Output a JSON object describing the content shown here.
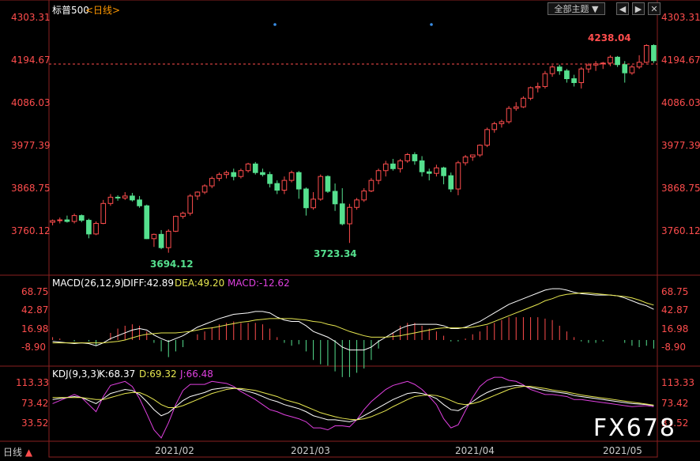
{
  "title": "标普500",
  "period": "<日线>",
  "toolbar": {
    "theme_select": "全部主题",
    "btn_prev": "◀",
    "btn_next": "▶",
    "btn_close": "✕"
  },
  "price_axis": [
    "4303.31",
    "4194.67",
    "4086.03",
    "3977.39",
    "3868.75",
    "3760.12"
  ],
  "annotations": {
    "high": "4238.04",
    "low1": "3694.12",
    "low2": "3723.34"
  },
  "macd": {
    "label": "MACD(26,12,9)",
    "diff": "DIFF:42.89",
    "dea": "DEA:49.20",
    "macd": "MACD:-12.62",
    "axis": [
      "68.75",
      "42.87",
      "16.98",
      "-8.90"
    ]
  },
  "kdj": {
    "label": "KDJ(9,3,3)",
    "k": "K:68.37",
    "d": "D:69.32",
    "j": "J:66.48",
    "axis": [
      "113.33",
      "73.42",
      "33.52"
    ]
  },
  "dates": [
    "2021/02",
    "2021/03",
    "2021/04",
    "2021/05"
  ],
  "period_tab": "日线",
  "watermark": "FX678",
  "colors": {
    "up": "#ff4d4d",
    "down": "#55e08e",
    "diff": "#ffffff",
    "dea": "#e8e850",
    "jline": "#e040e0",
    "grid": "#8a1f1f"
  },
  "chart_data": {
    "type": "candlestick",
    "ohlc": [
      [
        3783,
        3790,
        3775,
        3787
      ],
      [
        3787,
        3795,
        3780,
        3789
      ],
      [
        3789,
        3800,
        3782,
        3785
      ],
      [
        3785,
        3805,
        3780,
        3800
      ],
      [
        3800,
        3803,
        3783,
        3788
      ],
      [
        3788,
        3792,
        3742,
        3753
      ],
      [
        3753,
        3785,
        3750,
        3780
      ],
      [
        3780,
        3840,
        3778,
        3831
      ],
      [
        3831,
        3855,
        3825,
        3847
      ],
      [
        3847,
        3852,
        3838,
        3845
      ],
      [
        3845,
        3860,
        3840,
        3850
      ],
      [
        3850,
        3858,
        3836,
        3840
      ],
      [
        3840,
        3850,
        3820,
        3825
      ],
      [
        3825,
        3828,
        3740,
        3741
      ],
      [
        3741,
        3754,
        3720,
        3752
      ],
      [
        3752,
        3763,
        3714,
        3718
      ],
      [
        3718,
        3765,
        3705,
        3760
      ],
      [
        3760,
        3800,
        3758,
        3798
      ],
      [
        3798,
        3810,
        3792,
        3806
      ],
      [
        3806,
        3855,
        3800,
        3850
      ],
      [
        3850,
        3862,
        3840,
        3860
      ],
      [
        3860,
        3880,
        3855,
        3876
      ],
      [
        3876,
        3900,
        3870,
        3895
      ],
      [
        3895,
        3910,
        3888,
        3905
      ],
      [
        3905,
        3915,
        3895,
        3910
      ],
      [
        3910,
        3920,
        3890,
        3900
      ],
      [
        3900,
        3920,
        3895,
        3915
      ],
      [
        3915,
        3935,
        3910,
        3932
      ],
      [
        3932,
        3937,
        3905,
        3910
      ],
      [
        3910,
        3920,
        3900,
        3905
      ],
      [
        3905,
        3912,
        3872,
        3882
      ],
      [
        3882,
        3890,
        3855,
        3865
      ],
      [
        3865,
        3900,
        3855,
        3890
      ],
      [
        3890,
        3915,
        3885,
        3910
      ],
      [
        3910,
        3914,
        3843,
        3868
      ],
      [
        3868,
        3872,
        3800,
        3820
      ],
      [
        3820,
        3860,
        3815,
        3842
      ],
      [
        3842,
        3905,
        3838,
        3900
      ],
      [
        3900,
        3903,
        3858,
        3862
      ],
      [
        3862,
        3882,
        3812,
        3830
      ],
      [
        3830,
        3870,
        3775,
        3779
      ],
      [
        3779,
        3830,
        3730,
        3821
      ],
      [
        3821,
        3845,
        3815,
        3840
      ],
      [
        3840,
        3870,
        3835,
        3863
      ],
      [
        3863,
        3896,
        3860,
        3890
      ],
      [
        3890,
        3920,
        3880,
        3915
      ],
      [
        3915,
        3940,
        3900,
        3932
      ],
      [
        3932,
        3945,
        3915,
        3920
      ],
      [
        3920,
        3945,
        3910,
        3940
      ],
      [
        3940,
        3960,
        3935,
        3956
      ],
      [
        3956,
        3962,
        3930,
        3940
      ],
      [
        3940,
        3952,
        3900,
        3912
      ],
      [
        3912,
        3920,
        3890,
        3908
      ],
      [
        3908,
        3930,
        3900,
        3922
      ],
      [
        3922,
        3925,
        3880,
        3902
      ],
      [
        3902,
        3910,
        3860,
        3868
      ],
      [
        3868,
        3940,
        3852,
        3935
      ],
      [
        3935,
        3955,
        3928,
        3950
      ],
      [
        3950,
        3955,
        3940,
        3955
      ],
      [
        3955,
        3982,
        3950,
        3980
      ],
      [
        3980,
        4025,
        3975,
        4020
      ],
      [
        4020,
        4040,
        4012,
        4035
      ],
      [
        4035,
        4045,
        4025,
        4040
      ],
      [
        4040,
        4080,
        4035,
        4074
      ],
      [
        4074,
        4090,
        4068,
        4078
      ],
      [
        4078,
        4105,
        4075,
        4100
      ],
      [
        4100,
        4130,
        4095,
        4127
      ],
      [
        4127,
        4140,
        4115,
        4130
      ],
      [
        4130,
        4170,
        4125,
        4163
      ],
      [
        4163,
        4185,
        4155,
        4180
      ],
      [
        4180,
        4186,
        4160,
        4170
      ],
      [
        4170,
        4175,
        4140,
        4150
      ],
      [
        4150,
        4160,
        4130,
        4140
      ],
      [
        4140,
        4180,
        4125,
        4175
      ],
      [
        4175,
        4190,
        4165,
        4185
      ],
      [
        4185,
        4195,
        4170,
        4188
      ],
      [
        4188,
        4193,
        4175,
        4190
      ],
      [
        4190,
        4210,
        4182,
        4205
      ],
      [
        4205,
        4208,
        4180,
        4186
      ],
      [
        4186,
        4195,
        4140,
        4165
      ],
      [
        4165,
        4185,
        4160,
        4180
      ],
      [
        4180,
        4210,
        4175,
        4192
      ],
      [
        4192,
        4238,
        4190,
        4235
      ],
      [
        4235,
        4238,
        4190,
        4196
      ]
    ],
    "diff": [
      -2,
      -3,
      -4,
      -5,
      -4,
      -5,
      -8,
      -4,
      2,
      6,
      10,
      14,
      16,
      14,
      7,
      2,
      -2,
      2,
      6,
      12,
      18,
      22,
      26,
      30,
      33,
      36,
      37,
      38,
      40,
      40,
      38,
      32,
      28,
      26,
      26,
      20,
      12,
      8,
      4,
      -2,
      -10,
      -14,
      -14,
      -14,
      -10,
      -2,
      4,
      10,
      16,
      20,
      22,
      22,
      22,
      22,
      20,
      16,
      16,
      18,
      22,
      26,
      32,
      38,
      44,
      50,
      54,
      58,
      62,
      66,
      70,
      72,
      72,
      70,
      67,
      65,
      64,
      63,
      63,
      63,
      62,
      59,
      55,
      51,
      48,
      43
    ],
    "dea": [
      -4,
      -4,
      -4,
      -4,
      -4,
      -4,
      -4,
      -4,
      -3,
      -2,
      0,
      3,
      6,
      8,
      9,
      10,
      10,
      10,
      11,
      12,
      14,
      16,
      17,
      19,
      21,
      23,
      25,
      26,
      28,
      29,
      30,
      30,
      30,
      30,
      29,
      28,
      26,
      25,
      22,
      20,
      16,
      12,
      9,
      6,
      4,
      4,
      4,
      5,
      6,
      8,
      10,
      12,
      14,
      16,
      17,
      17,
      17,
      17,
      18,
      20,
      22,
      26,
      30,
      34,
      38,
      42,
      46,
      50,
      55,
      58,
      62,
      64,
      65,
      66,
      66,
      65,
      64,
      63,
      62,
      61,
      59,
      56,
      52,
      49
    ],
    "k": [
      80,
      82,
      84,
      86,
      84,
      78,
      72,
      82,
      92,
      96,
      100,
      98,
      90,
      76,
      60,
      48,
      54,
      66,
      78,
      86,
      90,
      94,
      100,
      102,
      104,
      103,
      100,
      96,
      92,
      86,
      80,
      76,
      70,
      66,
      62,
      56,
      48,
      44,
      40,
      40,
      38,
      36,
      40,
      48,
      56,
      64,
      72,
      80,
      86,
      92,
      94,
      92,
      88,
      82,
      70,
      60,
      58,
      66,
      76,
      86,
      94,
      100,
      104,
      106,
      108,
      107,
      104,
      101,
      98,
      96,
      94,
      92,
      88,
      86,
      84,
      82,
      80,
      78,
      76,
      74,
      72,
      71,
      70,
      68
    ],
    "d": [
      84,
      84,
      84,
      84,
      84,
      82,
      80,
      80,
      84,
      88,
      92,
      94,
      94,
      88,
      80,
      70,
      64,
      64,
      68,
      74,
      80,
      86,
      92,
      96,
      100,
      102,
      102,
      100,
      98,
      94,
      90,
      86,
      80,
      76,
      72,
      66,
      60,
      54,
      50,
      46,
      43,
      41,
      40,
      42,
      46,
      52,
      58,
      66,
      73,
      80,
      86,
      88,
      89,
      88,
      84,
      78,
      72,
      70,
      72,
      76,
      82,
      88,
      94,
      100,
      104,
      106,
      106,
      104,
      102,
      99,
      97,
      95,
      92,
      89,
      87,
      85,
      83,
      81,
      79,
      77,
      75,
      73,
      71,
      69
    ],
    "j": [
      72,
      78,
      84,
      90,
      84,
      70,
      56,
      86,
      108,
      112,
      116,
      106,
      82,
      52,
      20,
      4,
      34,
      70,
      98,
      110,
      110,
      110,
      116,
      114,
      112,
      106,
      96,
      88,
      80,
      70,
      60,
      56,
      50,
      46,
      42,
      36,
      24,
      24,
      20,
      28,
      28,
      26,
      40,
      60,
      76,
      88,
      100,
      108,
      112,
      116,
      110,
      100,
      86,
      70,
      42,
      24,
      30,
      58,
      84,
      106,
      118,
      124,
      124,
      118,
      116,
      109,
      100,
      95,
      90,
      90,
      88,
      86,
      80,
      80,
      78,
      76,
      74,
      72,
      70,
      68,
      66,
      67,
      68,
      66
    ]
  }
}
